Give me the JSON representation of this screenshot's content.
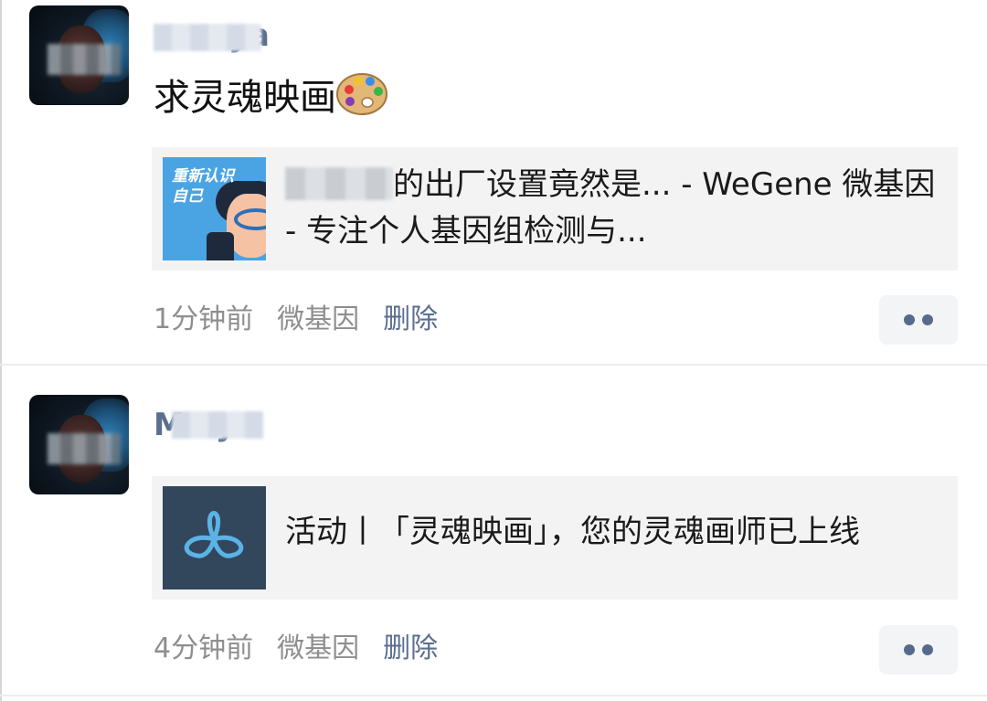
{
  "posts": [
    {
      "username": "aya",
      "text": "求灵魂映画",
      "link": {
        "thumbnail_caption_line1": "重新认识",
        "thumbnail_caption_line2": "自己",
        "title": "的出厂设置竟然是... - WeGene 微基因 - 专注个人基因组检测与..."
      },
      "time": "1分钟前",
      "source": "微基因",
      "delete_label": "删除"
    },
    {
      "username": "M aya",
      "link": {
        "title": "活动丨「灵魂映画」，您的灵魂画师已上线"
      },
      "time": "4分钟前",
      "source": "微基因",
      "delete_label": "删除"
    }
  ],
  "colors": {
    "username": "#5a6e8f",
    "meta_gray": "#8e8e8e",
    "card_background": "#f3f3f3",
    "soul_thumbnail": "#33475c",
    "soul_logo": "#5bb3e6"
  },
  "icons": [
    "palette-icon",
    "more-dots-icon",
    "soul-logo-icon"
  ]
}
